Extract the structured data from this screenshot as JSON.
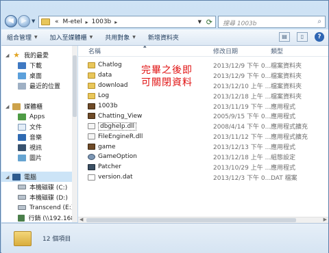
{
  "address": {
    "crumbs": [
      "«",
      "M-etel",
      "1003b"
    ],
    "search_placeholder": "搜尋 1003b"
  },
  "toolbar": {
    "organize": "組合管理",
    "add_to_library": "加入至媒體櫃",
    "share_with": "共用對象",
    "new_folder": "新增資料夾"
  },
  "nav": {
    "favorites": {
      "label": "我的最愛",
      "items": [
        "下載",
        "桌面",
        "最近的位置"
      ]
    },
    "libraries": {
      "label": "媒體櫃",
      "items": [
        "Apps",
        "文件",
        "音樂",
        "視訊",
        "圖片"
      ]
    },
    "computer": {
      "label": "電腦",
      "items": [
        "本機磁碟 (C:)",
        "本機磁碟 (D:)",
        "Transcend (E:)",
        "行銷 (\\\\192.168."
      ]
    }
  },
  "columns": {
    "name": "名稱",
    "date": "修改日期",
    "type": "類型"
  },
  "files": [
    {
      "icon": "folder",
      "name": "Chatlog",
      "date": "2013/12/9 下午 0...",
      "type": "檔案資料夾"
    },
    {
      "icon": "folder",
      "name": "data",
      "date": "2013/12/9 下午 0...",
      "type": "檔案資料夾"
    },
    {
      "icon": "folder",
      "name": "download",
      "date": "2013/12/10 上午 ...",
      "type": "檔案資料夾"
    },
    {
      "icon": "folder",
      "name": "Log",
      "date": "2013/12/18 上午 ...",
      "type": "檔案資料夾"
    },
    {
      "icon": "exe",
      "name": "1003b",
      "date": "2013/11/19 下午 ...",
      "type": "應用程式"
    },
    {
      "icon": "exe",
      "name": "Chatting_View",
      "date": "2005/9/15 下午 0...",
      "type": "應用程式"
    },
    {
      "icon": "dll",
      "name": "dbghelp.dll",
      "date": "2008/4/14 下午 0...",
      "type": "應用程式擴充"
    },
    {
      "icon": "dll",
      "name": "FileEngineR.dll",
      "date": "2013/11/12 下午 ...",
      "type": "應用程式擴充"
    },
    {
      "icon": "exe",
      "name": "game",
      "date": "2013/12/13 下午 ...",
      "type": "應用程式"
    },
    {
      "icon": "gear",
      "name": "GameOption",
      "date": "2013/12/18 上午 ...",
      "type": "組態設定"
    },
    {
      "icon": "patch",
      "name": "Patcher",
      "date": "2013/10/29 上午 ...",
      "type": "應用程式"
    },
    {
      "icon": "dat",
      "name": "version.dat",
      "date": "2013/12/3 下午 0...",
      "type": "DAT 檔案"
    }
  ],
  "annotation": {
    "line1": "完畢之後即",
    "line2": "可關閉資料"
  },
  "status": {
    "count": "12 個項目"
  }
}
